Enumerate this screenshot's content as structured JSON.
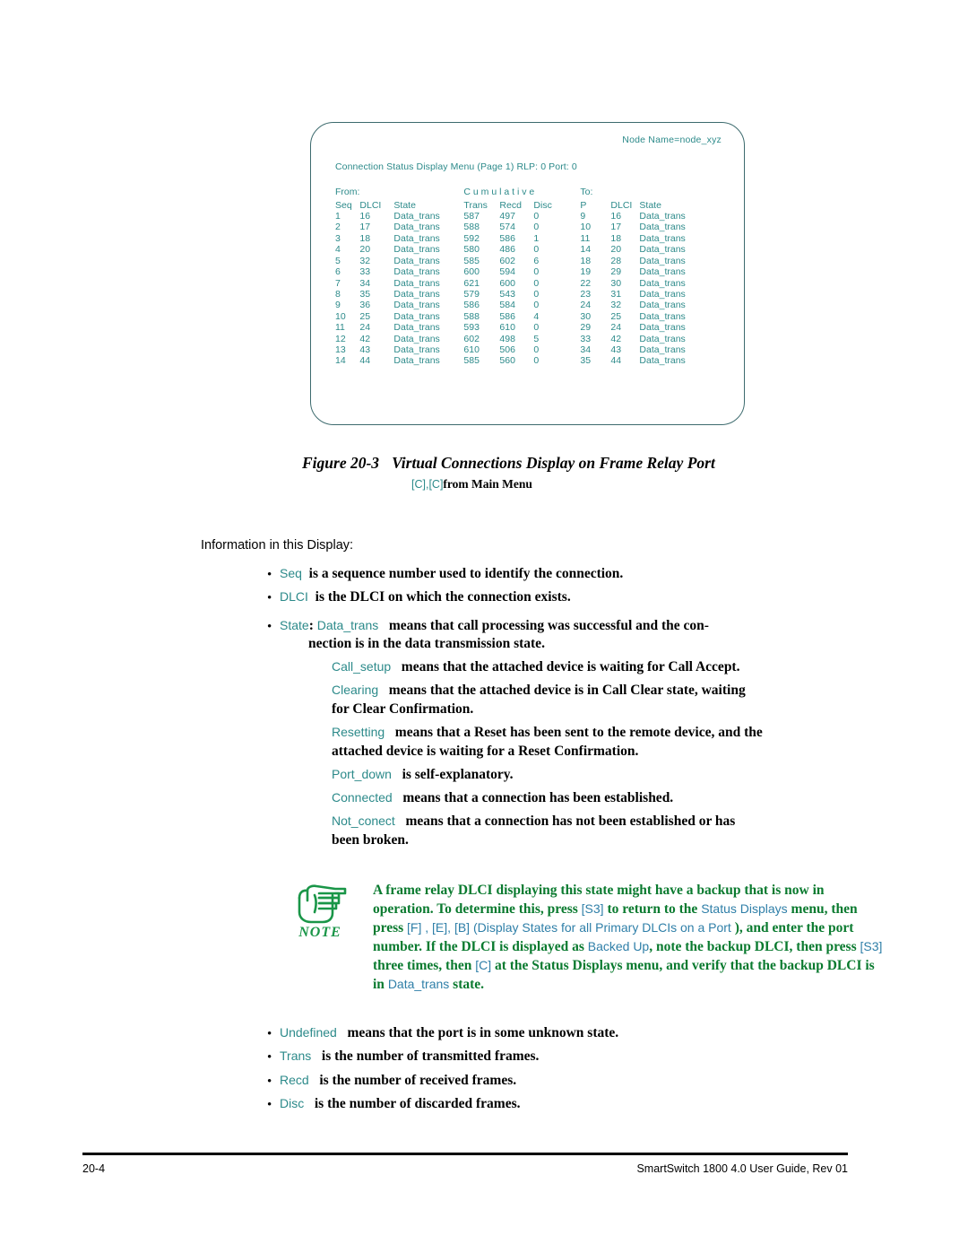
{
  "terminal": {
    "node_name": "Node Name=node_xyz",
    "menu_title": "Connection Status Display Menu (Page 1)   RLP: 0   Port: 0",
    "group_headers": {
      "from": "From:",
      "cumulative": "C u m u l a t i v e",
      "to": "To:"
    },
    "columns": [
      "Seq",
      "DLCI",
      "State",
      "Trans",
      "Recd",
      "Disc",
      "P",
      "DLCI",
      "State"
    ],
    "rows": [
      [
        "1",
        "16",
        "Data_trans",
        "587",
        "497",
        "0",
        "9",
        "16",
        "Data_trans"
      ],
      [
        "2",
        "17",
        "Data_trans",
        "588",
        "574",
        "0",
        "10",
        "17",
        "Data_trans"
      ],
      [
        "3",
        "18",
        "Data_trans",
        "592",
        "586",
        "1",
        "11",
        "18",
        "Data_trans"
      ],
      [
        "4",
        "20",
        "Data_trans",
        "580",
        "486",
        "0",
        "14",
        "20",
        "Data_trans"
      ],
      [
        "5",
        "32",
        "Data_trans",
        "585",
        "602",
        "6",
        "18",
        "28",
        "Data_trans"
      ],
      [
        "6",
        "33",
        "Data_trans",
        "600",
        "594",
        "0",
        "19",
        "29",
        "Data_trans"
      ],
      [
        "7",
        "34",
        "Data_trans",
        "621",
        "600",
        "0",
        "22",
        "30",
        "Data_trans"
      ],
      [
        "8",
        "35",
        "Data_trans",
        "579",
        "543",
        "0",
        "23",
        "31",
        "Data_trans"
      ],
      [
        "9",
        "36",
        "Data_trans",
        "586",
        "584",
        "0",
        "24",
        "32",
        "Data_trans"
      ],
      [
        "10",
        "25",
        "Data_trans",
        "588",
        "586",
        "4",
        "30",
        "25",
        "Data_trans"
      ],
      [
        "11",
        "24",
        "Data_trans",
        "593",
        "610",
        "0",
        "29",
        "24",
        "Data_trans"
      ],
      [
        "12",
        "42",
        "Data_trans",
        "602",
        "498",
        "5",
        "33",
        "42",
        "Data_trans"
      ],
      [
        "13",
        "43",
        "Data_trans",
        "610",
        "506",
        "0",
        "34",
        "43",
        "Data_trans"
      ],
      [
        "14",
        "44",
        "Data_trans",
        "585",
        "560",
        "0",
        "35",
        "44",
        "Data_trans"
      ]
    ]
  },
  "figure": {
    "number": "Figure 20-3",
    "title": "Virtual Connections Display on Frame Relay Port",
    "path_keys": "[C],[C]",
    "path_suffix": "from Main Menu"
  },
  "body": {
    "intro": "Information in this Display:",
    "bullets_top": [
      {
        "term": "Seq",
        "sep": "",
        "text": "is a sequence number used to identify the connection."
      },
      {
        "term": "DLCI",
        "sep": "",
        "text": "is the DLCI on which the connection exists."
      }
    ],
    "state_bullet": {
      "term": "State",
      "sep": ":",
      "value": "Data_trans",
      "text": "means that call processing was successful and the con-",
      "text2": "nection is in the data transmission state."
    },
    "state_defs": [
      {
        "term": "Call_setup",
        "text": "means that the attached device is waiting for Call Accept.",
        "text2": ""
      },
      {
        "term": "Clearing",
        "text": "means that the attached device is in Call Clear state, waiting",
        "text2": "for  Clear Confirmation."
      },
      {
        "term": "Resetting",
        "text": "means that a Reset has been sent to the remote device, and the",
        "text2": "attached device is waiting for a Reset Confirmation."
      },
      {
        "term": "Port_down",
        "text": "is self-explanatory.",
        "text2": ""
      },
      {
        "term": "Connected",
        "text": "means that a connection has been established.",
        "text2": ""
      },
      {
        "term": "Not_conect",
        "text": "means that a connection has not been established or has",
        "text2": "been broken."
      }
    ],
    "bullets_bottom": [
      {
        "term": "Undefined",
        "text": "means that the port is in some unknown state."
      },
      {
        "term": "Trans",
        "text": "is the number of transmitted frames."
      },
      {
        "term": "Recd",
        "text": "is the number of received frames."
      },
      {
        "term": "Disc",
        "text": "is the number of discarded frames."
      }
    ]
  },
  "note": {
    "label": "NOTE",
    "icon": "pointing-hand-icon",
    "seg": [
      {
        "kind": "bold",
        "text": "A frame relay DLCI displaying this state might have a backup that is now in operation. To determine this, press "
      },
      {
        "kind": "lit",
        "text": "[S3]"
      },
      {
        "kind": "bold",
        "text": " to return to the "
      },
      {
        "kind": "lit",
        "text": "Status Displays"
      },
      {
        "kind": "bold",
        "text": "  menu, then press "
      },
      {
        "kind": "lit",
        "text": "[F] , [E], [B]  (Display States for all Primary DLCIs on a Port "
      },
      {
        "kind": "bold",
        "text": "), and enter the port number. If the DLCI is displayed as "
      },
      {
        "kind": "lit",
        "text": "Backed Up"
      },
      {
        "kind": "bold",
        "text": ", note the backup DLCI, then press "
      },
      {
        "kind": "lit",
        "text": "[S3]"
      },
      {
        "kind": "bold",
        "text": " three times, then "
      },
      {
        "kind": "lit",
        "text": "[C]"
      },
      {
        "kind": "bold",
        "text": " at the Status Displays menu, and verify that the backup DLCI is in "
      },
      {
        "kind": "lit",
        "text": "Data_trans"
      },
      {
        "kind": "bold",
        "text": " state."
      }
    ]
  },
  "footer": {
    "page_number": "20-4",
    "guide": "SmartSwitch 1800 4.0 User Guide, Rev 01"
  },
  "colors": {
    "terminal_text": "#2c8a8a",
    "terminal_border": "#3d6b6e",
    "literal_teal": "#2c8a8a",
    "note_green": "#0a7a2f",
    "note_icon_green": "#1a9648",
    "note_literal_blue": "#2f7fa8"
  }
}
